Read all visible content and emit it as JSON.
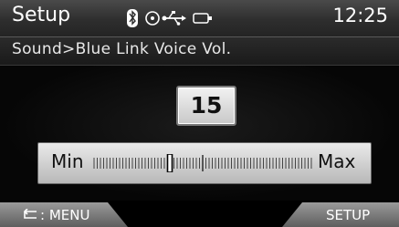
{
  "status_bar": {
    "title": "Setup",
    "time": "12:25",
    "icons": [
      "bluetooth-icon",
      "disc-icon",
      "usb-icon",
      "aux-icon"
    ]
  },
  "breadcrumb": "Sound>Blue Link Voice Vol.",
  "volume": {
    "value": "15",
    "min_label": "Min",
    "max_label": "Max",
    "level_fraction": 0.35
  },
  "bottom_bar": {
    "menu_label": ": MENU",
    "setup_label": "SETUP"
  }
}
